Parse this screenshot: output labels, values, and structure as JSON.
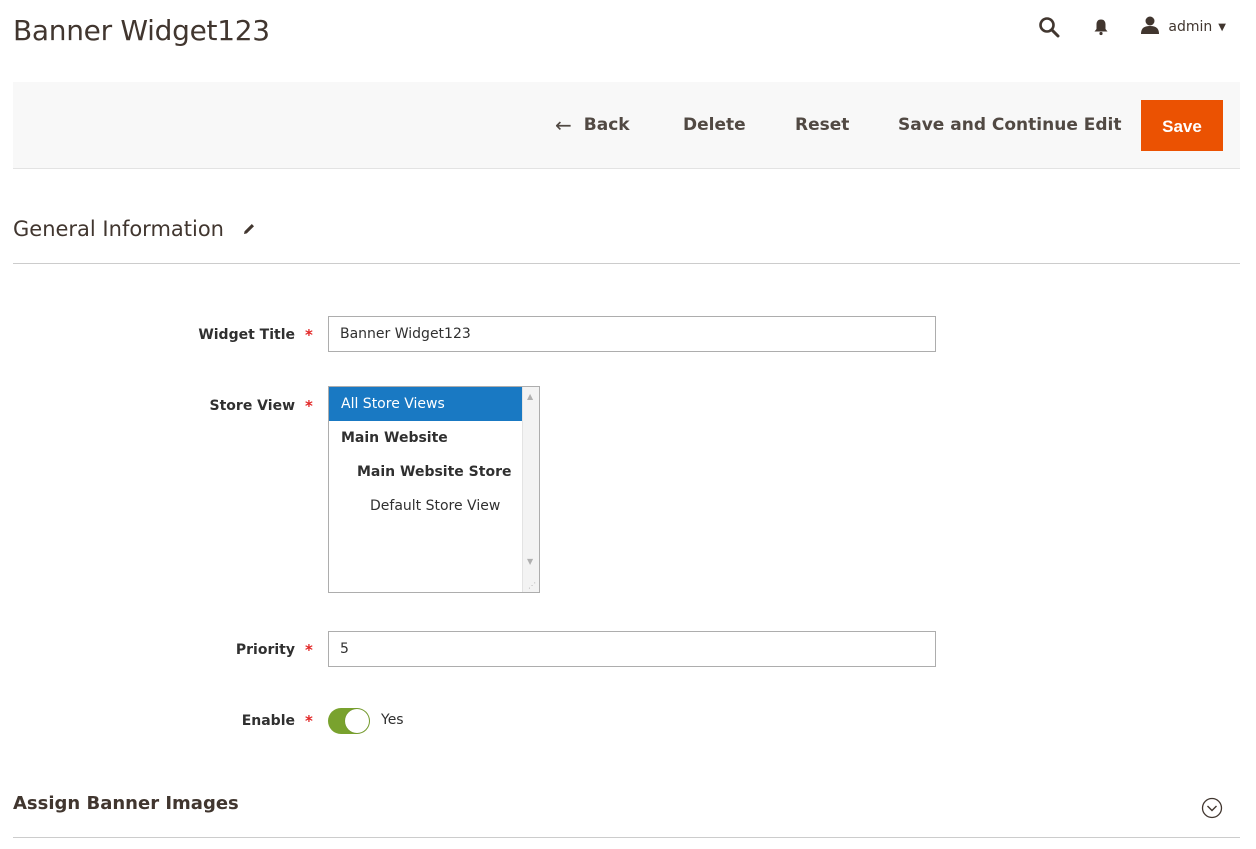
{
  "header": {
    "title": "Banner Widget123",
    "user_name": "admin",
    "icons": [
      "search-icon",
      "bell-icon",
      "user-icon"
    ]
  },
  "actions": {
    "back": "Back",
    "delete": "Delete",
    "reset": "Reset",
    "save_continue": "Save and Continue Edit",
    "save": "Save"
  },
  "section": {
    "title": "General Information"
  },
  "form": {
    "widget_title": {
      "label": "Widget Title",
      "value": "Banner Widget123"
    },
    "store_view": {
      "label": "Store View",
      "options": [
        "All Store Views",
        "Main Website",
        "Main Website Store",
        "Default Store View"
      ],
      "selected": "All Store Views"
    },
    "priority": {
      "label": "Priority",
      "value": "5"
    },
    "enable": {
      "label": "Enable",
      "value": "Yes",
      "on": true
    }
  },
  "collapsible": {
    "title": "Assign Banner Images"
  },
  "colors": {
    "accent": "#eb5202",
    "selected": "#1979c3",
    "toggle_on": "#79a22e",
    "required": "#e22626"
  }
}
